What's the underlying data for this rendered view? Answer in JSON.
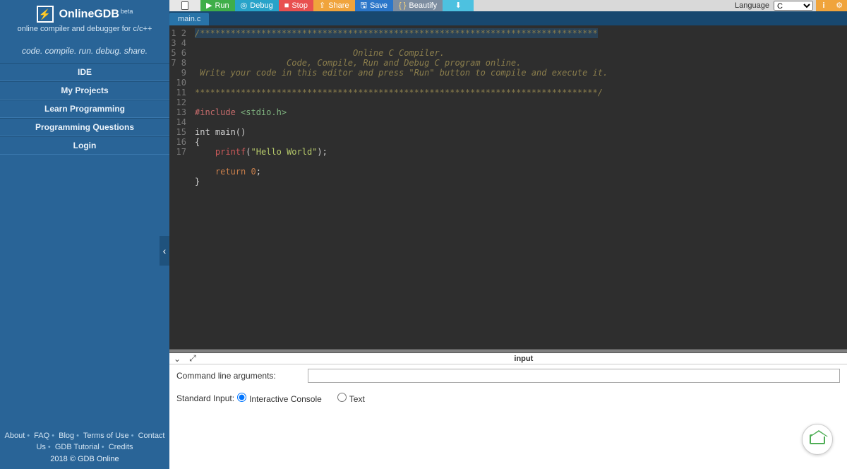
{
  "sidebar": {
    "title": "OnlineGDB",
    "beta": "beta",
    "subtitle": "online compiler and debugger for c/c++",
    "tagline": "code. compile. run. debug. share.",
    "nav": [
      "IDE",
      "My Projects",
      "Learn Programming",
      "Programming Questions",
      "Login"
    ],
    "footer_links": [
      "About",
      "FAQ",
      "Blog",
      "Terms of Use",
      "Contact Us",
      "GDB Tutorial",
      "Credits"
    ],
    "copyright": "2018 © GDB Online"
  },
  "toolbar": {
    "run": "Run",
    "debug": "Debug",
    "stop": "Stop",
    "share": "Share",
    "save": "Save",
    "beautify": "Beautify",
    "language_label": "Language",
    "language_value": "C"
  },
  "tabs": {
    "active": "main.c"
  },
  "code": {
    "lines": 17,
    "l1": "/******************************************************************************",
    "l3": "                               Online C Compiler.",
    "l4": "                  Code, Compile, Run and Debug C program online.",
    "l5": " Write your code in this editor and press \"Run\" button to compile and execute it.",
    "l7": "*******************************************************************************/",
    "l9a": "#include ",
    "l9b": "<stdio.h>",
    "l11": "int main()",
    "l12": "{",
    "l13a": "printf",
    "l13b": "(",
    "l13c": "\"Hello World\"",
    "l13d": ");",
    "l15a": "return ",
    "l15b": "0",
    "l15c": ";",
    "l16": "}"
  },
  "panel": {
    "title": "input",
    "cli_label": "Command line arguments:",
    "cli_value": "",
    "stdin_label": "Standard Input:",
    "opt_interactive": "Interactive Console",
    "opt_text": "Text"
  }
}
